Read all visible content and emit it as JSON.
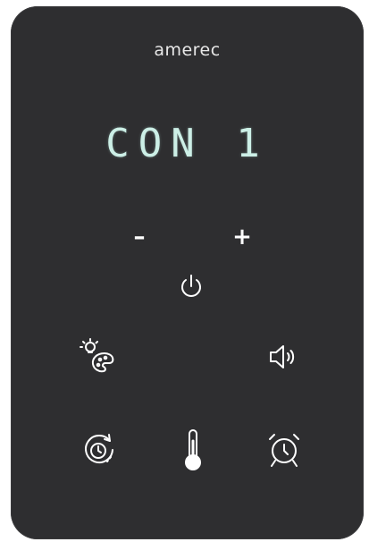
{
  "brand": "amerec",
  "display": {
    "text": "CON 1"
  },
  "controls": {
    "minus_label": "–",
    "plus_label": "+"
  },
  "icons": {
    "power": "power-icon",
    "light_color": "light-color-icon",
    "volume": "volume-icon",
    "timer": "timer-icon",
    "temperature": "thermometer-icon",
    "alarm": "alarm-clock-icon"
  },
  "colors": {
    "panel": "#2e2e30",
    "icon": "#ffffff",
    "display": "#ccefe6"
  }
}
